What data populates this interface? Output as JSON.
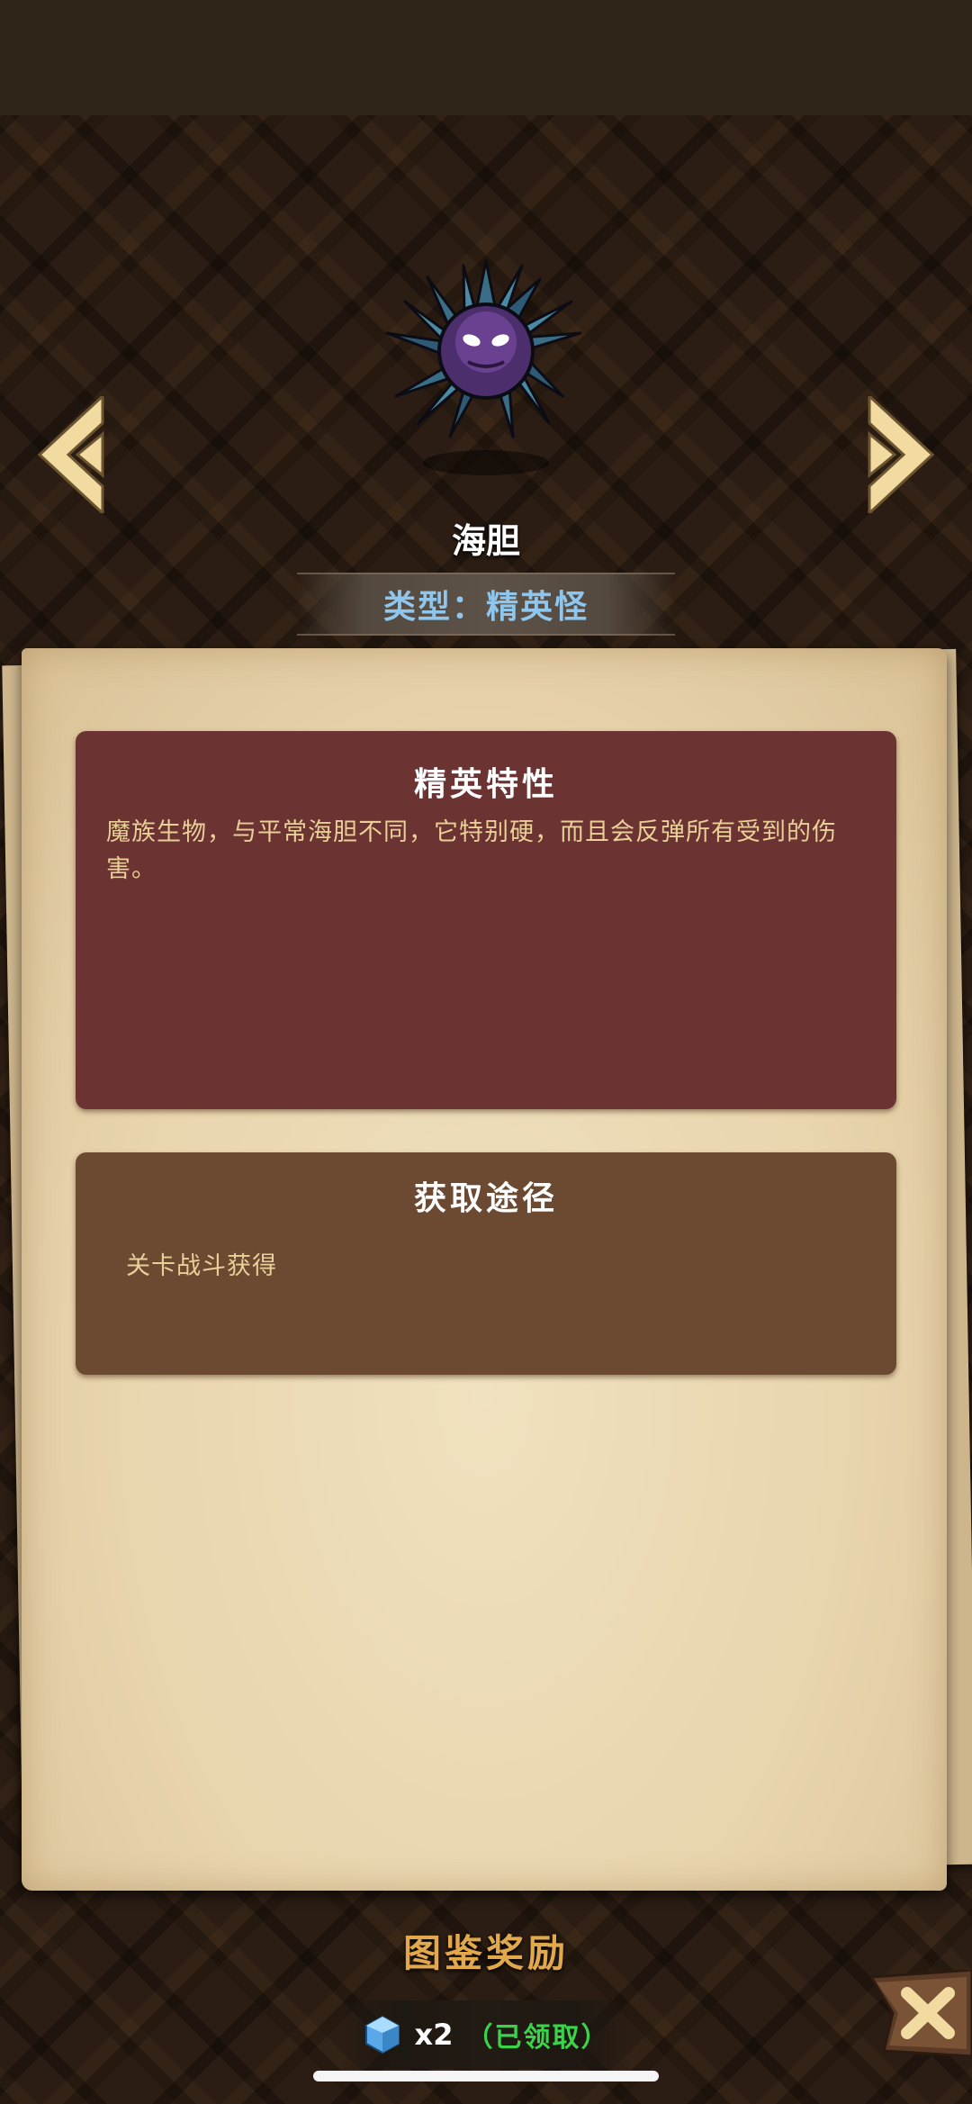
{
  "monster": {
    "name": "海胆",
    "type_label": "类型：精英怪"
  },
  "elite_trait": {
    "title": "精英特性",
    "description": "魔族生物，与平常海胆不同，它特别硬，而且会反弹所有受到的伤害。"
  },
  "obtain": {
    "title": "获取途径",
    "method": "关卡战斗获得"
  },
  "reward": {
    "title": "图鉴奖励",
    "count": "x2",
    "status": "（已领取）",
    "icon": "blue-gem-icon"
  },
  "icons": {
    "prev": "chevron-left-icon",
    "next": "chevron-right-icon",
    "close": "close-icon"
  },
  "colors": {
    "type_text": "#8fc6ee",
    "elite_card": "#6b3331",
    "obtain_card": "#6c4a32",
    "reward_title": "#e2a94c",
    "claimed_green": "#39d449"
  }
}
